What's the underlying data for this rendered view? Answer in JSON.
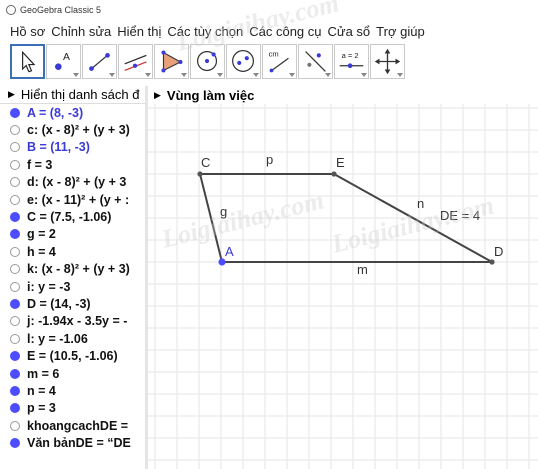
{
  "window": {
    "title": "GeoGebra Classic 5"
  },
  "menu": [
    "Hồ sơ",
    "Chỉnh sửa",
    "Hiển thị",
    "Các tùy chọn",
    "Các công cụ",
    "Cửa sổ",
    "Trợ giúp"
  ],
  "toolbar": {
    "tools": [
      {
        "name": "move-tool",
        "label": ""
      },
      {
        "name": "point-tool",
        "label": "A"
      },
      {
        "name": "line-tool",
        "label": ""
      },
      {
        "name": "perpendicular-tool",
        "label": ""
      },
      {
        "name": "polygon-tool",
        "label": ""
      },
      {
        "name": "circle-tool",
        "label": ""
      },
      {
        "name": "ellipse-tool",
        "label": ""
      },
      {
        "name": "angle-tool",
        "label": "cm"
      },
      {
        "name": "reflect-tool",
        "label": ""
      },
      {
        "name": "slider-tool",
        "label": "a = 2"
      },
      {
        "name": "move-graphics-tool",
        "label": ""
      }
    ]
  },
  "algebra": {
    "header": "Hiển thị danh sách đ",
    "items": [
      {
        "text": "A = (8, -3)",
        "shown": true,
        "blue": true
      },
      {
        "text": "c: (x - 8)² + (y + 3)",
        "shown": false,
        "blue": false
      },
      {
        "text": "B = (11, -3)",
        "shown": false,
        "blue": true
      },
      {
        "text": "f = 3",
        "shown": false,
        "blue": false
      },
      {
        "text": "d: (x - 8)² + (y + 3",
        "shown": false,
        "blue": false
      },
      {
        "text": "e: (x - 11)² + (y + :",
        "shown": false,
        "blue": false
      },
      {
        "text": "C = (7.5, -1.06)",
        "shown": true,
        "blue": false
      },
      {
        "text": "g = 2",
        "shown": true,
        "blue": false
      },
      {
        "text": "h = 4",
        "shown": false,
        "blue": false
      },
      {
        "text": "k: (x - 8)² + (y + 3)",
        "shown": false,
        "blue": false
      },
      {
        "text": "i: y = -3",
        "shown": false,
        "blue": false
      },
      {
        "text": "D = (14, -3)",
        "shown": true,
        "blue": false
      },
      {
        "text": "j: -1.94x - 3.5y = -",
        "shown": false,
        "blue": false
      },
      {
        "text": "l: y = -1.06",
        "shown": false,
        "blue": false
      },
      {
        "text": "E = (10.5, -1.06)",
        "shown": true,
        "blue": false
      },
      {
        "text": "m = 6",
        "shown": true,
        "blue": false
      },
      {
        "text": "n = 4",
        "shown": true,
        "blue": false
      },
      {
        "text": "p = 3",
        "shown": true,
        "blue": false
      },
      {
        "text": "khoangcachDE =",
        "shown": false,
        "blue": false
      },
      {
        "text": "Văn bảnDE = “DE",
        "shown": true,
        "blue": false
      }
    ]
  },
  "graphics": {
    "header": "Vùng làm việc",
    "labels": {
      "C": "C",
      "E": "E",
      "A": "A",
      "D": "D",
      "p": "p",
      "g": "g",
      "m": "m",
      "n": "n",
      "de_text": "DE = 4"
    },
    "colors": {
      "grid": "#e6e6e6",
      "segment": "#444444",
      "point_a": "#4d4dff",
      "point_dark": "#555555",
      "label_a": "#3a3ad6"
    }
  },
  "watermarks": [
    "Loigiaihay.com",
    "Loigiaihay.com",
    "Loigiaihay.com"
  ]
}
